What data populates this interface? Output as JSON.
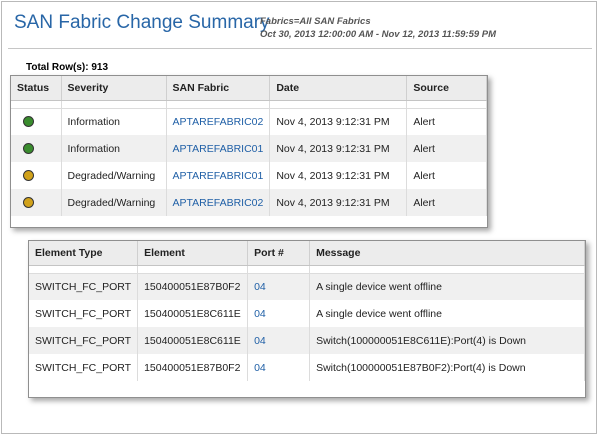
{
  "report": {
    "title": "SAN Fabric Change Summary",
    "filter_line": "Fabrics=All SAN Fabrics",
    "date_range": "Oct 30, 2013 12:00:00 AM - Nov 12, 2013 11:59:59 PM",
    "total_rows_label": "Total Row(s):",
    "total_rows_value": "913"
  },
  "table1": {
    "columns": [
      "Status",
      "Severity",
      "SAN Fabric",
      "Date",
      "Source"
    ],
    "rows": [
      {
        "status_color": "#3a8c2e",
        "severity": "Information",
        "fabric": "APTAREFABRIC02",
        "date": "Nov 4, 2013 9:12:31 PM",
        "source": "Alert"
      },
      {
        "status_color": "#3a8c2e",
        "severity": "Information",
        "fabric": "APTAREFABRIC01",
        "date": "Nov 4, 2013 9:12:31 PM",
        "source": "Alert"
      },
      {
        "status_color": "#d1a21b",
        "severity": "Degraded/Warning",
        "fabric": "APTAREFABRIC01",
        "date": "Nov 4, 2013 9:12:31 PM",
        "source": "Alert"
      },
      {
        "status_color": "#d1a21b",
        "severity": "Degraded/Warning",
        "fabric": "APTAREFABRIC02",
        "date": "Nov 4, 2013 9:12:31 PM",
        "source": "Alert"
      }
    ]
  },
  "table2": {
    "columns": [
      "Element Type",
      "Element",
      "Port #",
      "Message"
    ],
    "rows": [
      {
        "element_type": "SWITCH_FC_PORT",
        "element": "150400051E87B0F2",
        "port": "04",
        "message": "A single device went offline"
      },
      {
        "element_type": "SWITCH_FC_PORT",
        "element": "150400051E8C611E",
        "port": "04",
        "message": "A single device went offline"
      },
      {
        "element_type": "SWITCH_FC_PORT",
        "element": "150400051E8C611E",
        "port": "04",
        "message": "Switch(100000051E8C611E):Port(4) is Down"
      },
      {
        "element_type": "SWITCH_FC_PORT",
        "element": "150400051E87B0F2",
        "port": "04",
        "message": "Switch(100000051E87B0F2):Port(4) is Down"
      }
    ]
  }
}
